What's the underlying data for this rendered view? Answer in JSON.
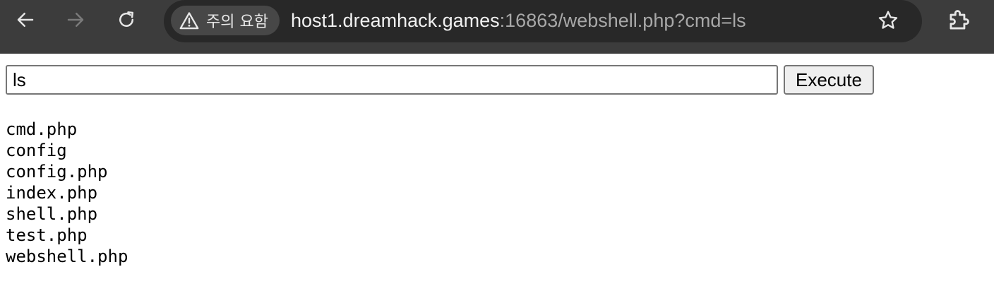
{
  "browser": {
    "security_chip_label": "주의 요함",
    "url_host": "host1.dreamhack.games",
    "url_path": ":16863/webshell.php?cmd=ls",
    "icons": {
      "back": "back-arrow-icon",
      "forward": "forward-arrow-icon",
      "reload": "reload-icon",
      "security": "warning-triangle-icon",
      "bookmark": "star-icon",
      "extensions": "puzzle-piece-icon"
    },
    "colors": {
      "toolbar_bg": "#3c3c3c",
      "omnibox_bg": "#282828",
      "chip_bg": "#474747"
    }
  },
  "form": {
    "cmd_value": "ls",
    "execute_label": "Execute"
  },
  "output": {
    "lines": [
      "cmd.php",
      "config",
      "config.php",
      "index.php",
      "shell.php",
      "test.php",
      "webshell.php"
    ]
  }
}
